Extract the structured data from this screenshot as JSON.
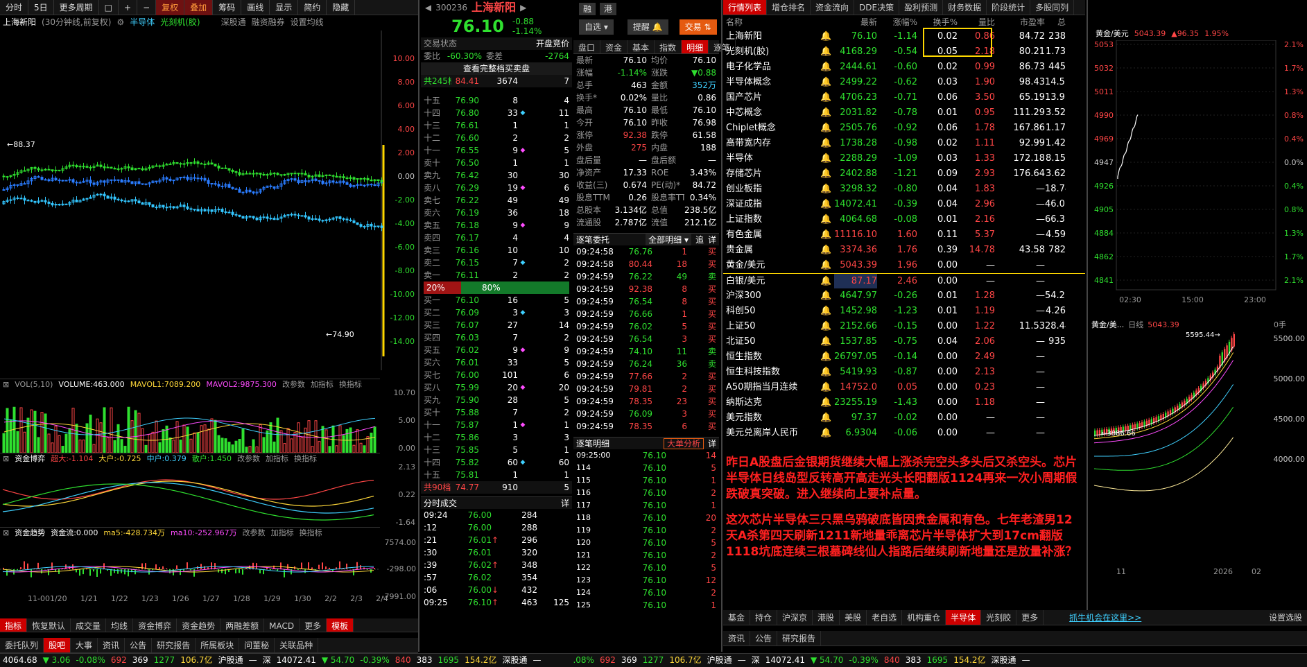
{
  "left": {
    "toolbar": [
      "分时",
      "5日",
      "更多周期",
      "□",
      "+",
      "−",
      "复权",
      "叠加",
      "筹码",
      "画线",
      "显示",
      "简约",
      "隐藏"
    ],
    "info": {
      "name": "上海新阳",
      "cycle": "(30分钟线,前复权)",
      "tag1": "半导体",
      "tag2": "光刻机(胶)",
      "links": [
        "深股通",
        "融资融券",
        "设置均线"
      ]
    },
    "price_axis": [
      "10.00",
      "8.00",
      "6.00",
      "4.00",
      "2.00",
      "0.00",
      "-2.00",
      "-4.00",
      "-6.00",
      "-8.00",
      "-10.00",
      "-12.00",
      "-14.00"
    ],
    "high_label": "88.37",
    "low_label": "74.90",
    "vol": {
      "title": "VOL(5,10)",
      "volume": "VOLUME:463.000",
      "ma1": "MAVOL1:7089.200",
      "ma2": "MAVOL2:9875.300",
      "btns": [
        "改参数",
        "加指标",
        "换指标"
      ],
      "axis": [
        "10.70",
        "5.00",
        "0.00"
      ]
    },
    "fund": {
      "title": "资金博弈",
      "super": "超大:-1.104",
      "big": "大户:-0.725",
      "mid": "中户:0.379",
      "small": "散户:1.450",
      "btns": [
        "改参数",
        "加指标",
        "换指标"
      ],
      "axis": [
        "2.13",
        "0.22",
        "-1.64"
      ]
    },
    "trend": {
      "title": "资金趋势",
      "flow": "资金流:0.000",
      "ma5": "ma5:-428.734万",
      "ma10": "ma10:-252.967万",
      "btns": [
        "改参数",
        "加指标",
        "换指标"
      ],
      "axis": [
        "7574.00",
        "-298.00",
        "-7991.00"
      ]
    },
    "dates": [
      "11-001/20",
      "1/21",
      "1/22",
      "1/23",
      "1/26",
      "1/27",
      "1/28",
      "1/29",
      "1/30",
      "2/2",
      "2/3",
      "2/4"
    ],
    "bottom_tabs": [
      "指标",
      "恢复默认",
      "成交量",
      "均线",
      "资金博弈",
      "资金趋势",
      "两融差额",
      "MACD",
      "更多",
      "模板"
    ]
  },
  "quote": {
    "code": "300236",
    "name": "上海新阳",
    "btn1": "融",
    "btn2": "港",
    "price": "76.10",
    "change": "-0.88",
    "pct": "-1.14%",
    "btns": {
      "watch": "自选",
      "alert": "提醒",
      "trade": "交易"
    },
    "status_label": "交易状态",
    "status_value": "开盘竞价",
    "weibi_label": "委比",
    "weibi": "-60.30%",
    "weicha_label": "委差",
    "weicha": "-2764",
    "full_book": "查看完整档买卖盘",
    "total_asks": {
      "label": "共245档",
      "price": "84.41",
      "vol": "3674",
      "n": "7"
    },
    "asks": [
      [
        "十五",
        "76.90",
        "8",
        "4"
      ],
      [
        "十四",
        "76.80",
        "33",
        "11"
      ],
      [
        "十三",
        "76.61",
        "1",
        "1"
      ],
      [
        "十二",
        "76.60",
        "2",
        "2"
      ],
      [
        "十一",
        "76.55",
        "9",
        "5"
      ],
      [
        "卖十",
        "76.50",
        "1",
        "1"
      ],
      [
        "卖九",
        "76.42",
        "30",
        "30"
      ],
      [
        "卖八",
        "76.29",
        "19",
        "6"
      ],
      [
        "卖七",
        "76.22",
        "49",
        "49"
      ],
      [
        "卖六",
        "76.19",
        "36",
        "18"
      ],
      [
        "卖五",
        "76.18",
        "9",
        "9"
      ],
      [
        "卖四",
        "76.17",
        "4",
        "4"
      ],
      [
        "卖三",
        "76.16",
        "10",
        "10"
      ],
      [
        "卖二",
        "76.15",
        "7",
        "2"
      ],
      [
        "卖一",
        "76.11",
        "2",
        "2"
      ]
    ],
    "ratio": {
      "buy": "20%",
      "sell": "80%"
    },
    "bids": [
      [
        "买一",
        "76.10",
        "16",
        "5"
      ],
      [
        "买二",
        "76.09",
        "3",
        "3"
      ],
      [
        "买三",
        "76.07",
        "27",
        "14"
      ],
      [
        "买四",
        "76.03",
        "7",
        "2"
      ],
      [
        "买五",
        "76.02",
        "9",
        "9"
      ],
      [
        "买六",
        "76.01",
        "33",
        "5"
      ],
      [
        "买七",
        "76.00",
        "101",
        "6"
      ],
      [
        "买八",
        "75.99",
        "20",
        "20"
      ],
      [
        "买九",
        "75.90",
        "28",
        "5"
      ],
      [
        "买十",
        "75.88",
        "7",
        "2"
      ],
      [
        "十一",
        "75.87",
        "1",
        "1"
      ],
      [
        "十二",
        "75.86",
        "3",
        "3"
      ],
      [
        "十三",
        "75.85",
        "5",
        "1"
      ],
      [
        "十四",
        "75.82",
        "60",
        "60"
      ],
      [
        "十五",
        "75.81",
        "1",
        "1"
      ]
    ],
    "total_bids": {
      "label": "共90档",
      "price": "74.77",
      "vol": "910",
      "n": "5"
    }
  },
  "detail": {
    "tabs": [
      "盘口",
      "资金",
      "基本",
      "指数",
      "明细",
      "逐笔"
    ],
    "rows": [
      [
        "最新",
        "76.10",
        "均价",
        "76.10"
      ],
      [
        "涨幅",
        "-1.14%",
        "涨跌",
        "▼0.88"
      ],
      [
        "总手",
        "463",
        "金额",
        "352万"
      ],
      [
        "换手*",
        "0.02%",
        "量比",
        "0.86"
      ],
      [
        "最高",
        "76.10",
        "最低",
        "76.10"
      ],
      [
        "今开",
        "76.10",
        "昨收",
        "76.98"
      ],
      [
        "涨停",
        "92.38",
        "跌停",
        "61.58"
      ],
      [
        "外盘",
        "275",
        "内盘",
        "188"
      ],
      [
        "盘后量",
        "—",
        "盘后额",
        "—"
      ],
      [
        "净资产",
        "17.33",
        "ROE",
        "3.43%"
      ],
      [
        "收益(三)",
        "0.674",
        "PE(动)*",
        "84.72"
      ],
      [
        "股息TTM",
        "0.26",
        "股息率TTM",
        "0.34%"
      ],
      [
        "总股本",
        "3.134亿",
        "总值",
        "238.5亿"
      ],
      [
        "流通股",
        "2.787亿",
        "流值",
        "212.1亿"
      ]
    ],
    "orders_title": "逐笔委托",
    "orders_filter": "全部明细",
    "orders_btn1": "追",
    "orders_btn2": "详",
    "orders": [
      [
        "09:24:58",
        "76.76",
        "1",
        "买"
      ],
      [
        "09:24:58",
        "80.44",
        "18",
        "买"
      ],
      [
        "09:24:59",
        "76.22",
        "49",
        "卖"
      ],
      [
        "09:24:59",
        "92.38",
        "8",
        "买"
      ],
      [
        "09:24:59",
        "76.54",
        "8",
        "买"
      ],
      [
        "09:24:59",
        "76.66",
        "1",
        "买"
      ],
      [
        "09:24:59",
        "76.02",
        "5",
        "买"
      ],
      [
        "09:24:59",
        "76.54",
        "3",
        "买"
      ],
      [
        "09:24:59",
        "74.10",
        "11",
        "卖"
      ],
      [
        "09:24:59",
        "76.24",
        "36",
        "卖"
      ],
      [
        "09:24:59",
        "77.66",
        "2",
        "买"
      ],
      [
        "09:24:59",
        "79.81",
        "2",
        "买"
      ],
      [
        "09:24:59",
        "78.35",
        "23",
        "买"
      ],
      [
        "09:24:59",
        "76.09",
        "3",
        "买"
      ],
      [
        "09:24:59",
        "78.35",
        "6",
        "买"
      ]
    ],
    "trades_title": "逐笔明细",
    "trades_btn": "大单分析",
    "trades_btn2": "详",
    "trades": [
      [
        "09:25:00",
        "76.10",
        "14"
      ],
      [
        "114",
        "76.10",
        "5"
      ],
      [
        "115",
        "76.10",
        "1"
      ],
      [
        "116",
        "76.10",
        "2"
      ],
      [
        "117",
        "76.10",
        "1"
      ],
      [
        "118",
        "76.10",
        "20"
      ],
      [
        "119",
        "76.10",
        "2"
      ],
      [
        "120",
        "76.10",
        "5"
      ],
      [
        "121",
        "76.10",
        "2"
      ],
      [
        "122",
        "76.10",
        "5"
      ],
      [
        "123",
        "76.10",
        "12"
      ],
      [
        "124",
        "76.10",
        "2"
      ],
      [
        "125",
        "76.10",
        "1"
      ]
    ]
  },
  "minute": {
    "title": "分时成交",
    "btn": "详",
    "rows": [
      [
        "09:24",
        "76.00",
        "284"
      ],
      [
        ":12",
        "76.00",
        "288"
      ],
      [
        ":21",
        "76.01",
        "296"
      ],
      [
        ":30",
        "76.01",
        "320"
      ],
      [
        ":39",
        "76.02",
        "348"
      ],
      [
        ":57",
        "76.02",
        "354"
      ],
      [
        ":06",
        "76.00",
        "432"
      ],
      [
        "09:25",
        "76.10",
        "463",
        "125"
      ]
    ]
  },
  "list": {
    "tabs": [
      "行情列表",
      "增仓排名",
      "资金流向",
      "DDE决策",
      "盈利预测",
      "财务数据",
      "阶段统计",
      "多股同列"
    ],
    "headers": [
      "名称",
      "",
      "最新",
      "涨幅%",
      "换手%",
      "量比",
      "市盈率",
      "总"
    ],
    "rows": [
      [
        "上海新阳",
        "76.10",
        "-1.14",
        "0.02",
        "0.86",
        "84.72",
        "238"
      ],
      [
        "光刻机(胶)",
        "4168.29",
        "-0.54",
        "0.05",
        "2.18",
        "80.21",
        "1.73"
      ],
      [
        "电子化学品",
        "2444.61",
        "-0.60",
        "0.02",
        "0.99",
        "86.73",
        "445"
      ],
      [
        "半导体概念",
        "2499.22",
        "-0.62",
        "0.03",
        "1.90",
        "98.43",
        "14.51"
      ],
      [
        "国产芯片",
        "4706.23",
        "-0.71",
        "0.06",
        "3.50",
        "65.19",
        "13.95"
      ],
      [
        "中芯概念",
        "2031.82",
        "-0.78",
        "0.01",
        "0.95",
        "111.29",
        "3.52"
      ],
      [
        "Chiplet概念",
        "2505.76",
        "-0.92",
        "0.06",
        "1.78",
        "167.86",
        "1.17"
      ],
      [
        "高带宽内存",
        "1738.28",
        "-0.98",
        "0.02",
        "1.11",
        "92.99",
        "1.42"
      ],
      [
        "半导体",
        "2288.29",
        "-1.09",
        "0.03",
        "1.33",
        "172.18",
        "8.15"
      ],
      [
        "存储芯片",
        "2402.88",
        "-1.21",
        "0.09",
        "2.93",
        "176.64",
        "3.62"
      ],
      [
        "创业板指",
        "3298.32",
        "-0.80",
        "0.04",
        "1.83",
        "—",
        "18.74"
      ],
      [
        "深证成指",
        "14072.41",
        "-0.39",
        "0.04",
        "2.96",
        "—",
        "46.03"
      ],
      [
        "上证指数",
        "4064.68",
        "-0.08",
        "0.01",
        "2.16",
        "—",
        "66.37"
      ],
      [
        "有色金属",
        "11116.10",
        "1.60",
        "0.11",
        "5.37",
        "—",
        "4.59"
      ],
      [
        "贵金属",
        "3374.36",
        "1.76",
        "0.39",
        "14.78",
        "43.58",
        "782"
      ],
      [
        "黄金/美元",
        "5043.39",
        "1.96",
        "0.00",
        "—",
        "—",
        ""
      ],
      [
        "白银/美元",
        "87.17",
        "2.46",
        "0.00",
        "—",
        "—",
        ""
      ],
      [
        "沪深300",
        "4647.97",
        "-0.26",
        "0.01",
        "1.28",
        "—",
        "54.23"
      ],
      [
        "科创50",
        "1452.98",
        "-1.23",
        "0.01",
        "1.19",
        "—",
        "4.26"
      ],
      [
        "上证50",
        "2152.66",
        "-0.15",
        "0.00",
        "1.22",
        "11.53",
        "28.44"
      ],
      [
        "北证50",
        "1537.85",
        "-0.75",
        "0.04",
        "2.06",
        "—",
        "935"
      ],
      [
        "恒生指数",
        "26797.05",
        "-0.14",
        "0.00",
        "2.49",
        "—",
        ""
      ],
      [
        "恒生科技指数",
        "5419.93",
        "-0.87",
        "0.00",
        "2.13",
        "—",
        ""
      ],
      [
        "A50期指当月连续",
        "14752.0",
        "0.05",
        "0.00",
        "0.23",
        "—",
        ""
      ],
      [
        "纳斯达克",
        "23255.19",
        "-1.43",
        "0.00",
        "1.18",
        "—",
        ""
      ],
      [
        "美元指数",
        "97.37",
        "-0.02",
        "0.00",
        "—",
        "—",
        ""
      ],
      [
        "美元兑离岸人民币",
        "6.9304",
        "-0.06",
        "0.00",
        "—",
        "—",
        ""
      ]
    ],
    "note1": "昨日A股盘后金银期货继续大幅上涨杀完空头多头后又杀空头。芯片半导体日线岛型反转高开高走光头长阳翻版1124再来一次小周期假跌破真突破。进入继续向上要补点量。",
    "note2": "这次芯片半导体三只黑乌鸦破底皆因贵金属和有色。七年老渣男12天A杀第四天刷新1211新地量乖离芯片半导体扩大到17cm翻版1118坑底连续三根墓碑线仙人指路后继续刷新地量还是放量补涨？",
    "bottom_tabs": [
      "基金",
      "持仓",
      "沪深京",
      "港股",
      "美股",
      "老自选",
      "机构重仓",
      "半导体",
      "光刻胶",
      "更多"
    ],
    "bottom_link": "抓牛机会在这里>>",
    "bottom_set": "设置选股"
  },
  "gold": {
    "title": "黄金/美元",
    "price": "5043.39",
    "chg": "96.35",
    "pct": "1.95%",
    "axis": [
      "5053",
      "5032",
      "5011",
      "4990",
      "4969",
      "4947",
      "4926",
      "4905",
      "4884",
      "4862",
      "4841"
    ],
    "pct_axis": [
      "2.1%",
      "1.7%",
      "1.3%",
      "0.8%",
      "0.4%",
      "0.0%",
      "0.4%",
      "0.8%",
      "1.3%",
      "1.7%",
      "2.1%"
    ],
    "times": [
      "02:30",
      "15:00",
      "23:00"
    ],
    "daily_title": "黄金/美...",
    "daily_sub": "日线",
    "daily_price": "5043.39",
    "daily_hand": "0手",
    "daily_axis": [
      "5500.00",
      "5000.00",
      "4500.00",
      "4000.00"
    ],
    "daily_high": "5595.44",
    "daily_low": "3886.66",
    "daily_dates": [
      "11",
      "2026",
      "02"
    ]
  },
  "bottom_left_tabs": [
    "委托队列",
    "股吧",
    "大事",
    "资讯",
    "公告",
    "研究报告",
    "所属板块",
    "问董秘",
    "关联品种"
  ],
  "bottom_right_tabs": [
    "资讯",
    "公告",
    "研究报告"
  ],
  "status": [
    {
      "t": "4064.68",
      "c": "white"
    },
    {
      "t": "▼ 3.06",
      "c": "green"
    },
    {
      "t": "-0.08%",
      "c": "green"
    },
    {
      "t": "692",
      "c": "red"
    },
    {
      "t": "369",
      "c": "white"
    },
    {
      "t": "1277",
      "c": "green"
    },
    {
      "t": "106.7亿",
      "c": "yellow"
    },
    {
      "t": "沪股通",
      "c": "white"
    },
    {
      "t": "—",
      "c": "white"
    },
    {
      "t": "深",
      "c": "white"
    },
    {
      "t": "14072.41",
      "c": "white"
    },
    {
      "t": "▼ 54.70",
      "c": "green"
    },
    {
      "t": "-0.39%",
      "c": "green"
    },
    {
      "t": "840",
      "c": "red"
    },
    {
      "t": "383",
      "c": "white"
    },
    {
      "t": "1695",
      "c": "green"
    },
    {
      "t": "154.2亿",
      "c": "yellow"
    },
    {
      "t": "深股通",
      "c": "white"
    },
    {
      "t": "—",
      "c": "white"
    }
  ],
  "status_right": [
    {
      "t": ".08%",
      "c": "green"
    },
    {
      "t": "692",
      "c": "red"
    },
    {
      "t": "369",
      "c": "white"
    },
    {
      "t": "1277",
      "c": "green"
    },
    {
      "t": "106.7亿",
      "c": "yellow"
    },
    {
      "t": "沪股通",
      "c": "white"
    },
    {
      "t": "—",
      "c": "white"
    },
    {
      "t": "深",
      "c": "white"
    },
    {
      "t": "14072.41",
      "c": "white"
    },
    {
      "t": "▼ 54.70",
      "c": "green"
    },
    {
      "t": "-0.39%",
      "c": "green"
    },
    {
      "t": "840",
      "c": "red"
    },
    {
      "t": "383",
      "c": "white"
    },
    {
      "t": "1695",
      "c": "green"
    },
    {
      "t": "154.2亿",
      "c": "yellow"
    },
    {
      "t": "深股通",
      "c": "white"
    },
    {
      "t": "—",
      "c": "white"
    }
  ],
  "colors": {
    "up": "#ff4646",
    "down": "#2fe02f",
    "accent": "#ffd83a",
    "bg": "#000000"
  }
}
